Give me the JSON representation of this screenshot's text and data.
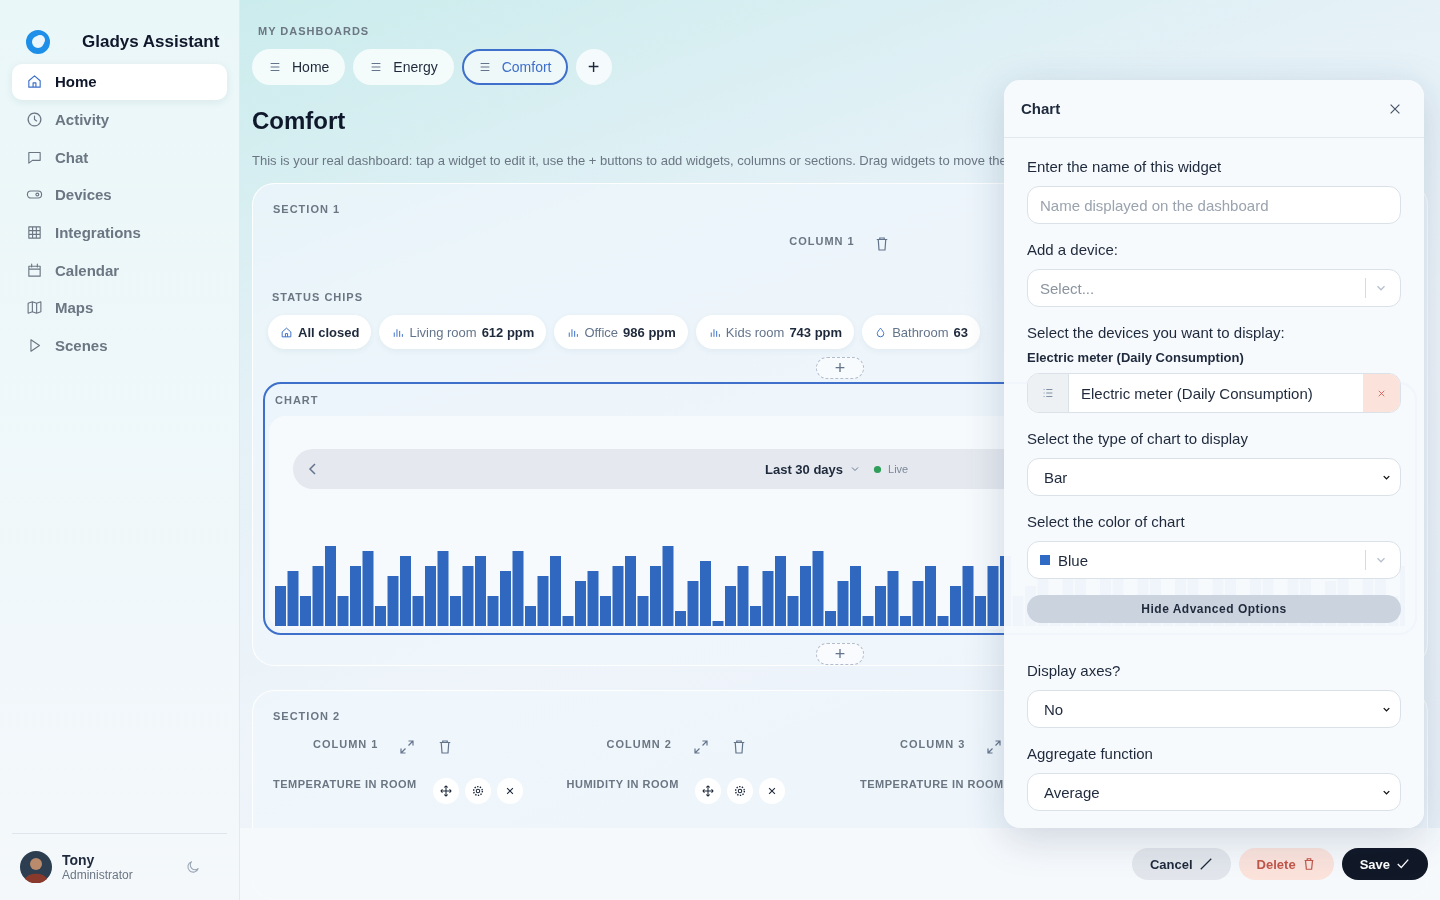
{
  "app": {
    "name": "Gladys Assistant"
  },
  "sidebar": {
    "items": [
      {
        "label": "Home",
        "selected": true
      },
      {
        "label": "Activity",
        "selected": false
      },
      {
        "label": "Chat",
        "selected": false
      },
      {
        "label": "Devices",
        "selected": false
      },
      {
        "label": "Integrations",
        "selected": false
      },
      {
        "label": "Calendar",
        "selected": false
      },
      {
        "label": "Maps",
        "selected": false
      },
      {
        "label": "Scenes",
        "selected": false
      }
    ]
  },
  "user": {
    "name": "Tony",
    "role": "Administrator"
  },
  "dashboards": {
    "heading": "MY DASHBOARDS",
    "tabs": [
      {
        "label": "Home",
        "selected": false
      },
      {
        "label": "Energy",
        "selected": false
      },
      {
        "label": "Comfort",
        "selected": true
      }
    ],
    "add": "+"
  },
  "page": {
    "title": "Comfort",
    "description": "This is your real dashboard: tap a widget to edit it, use the + buttons to add widgets, columns or sections. Drag widgets to move the"
  },
  "section_1": {
    "title": "SECTION 1",
    "column": "COLUMN 1",
    "status_chips": {
      "title": "STATUS CHIPS",
      "chips": [
        {
          "kind": "state",
          "label": "All closed"
        },
        {
          "kind": "co2",
          "label": "Living room",
          "value": "612 ppm"
        },
        {
          "kind": "co2",
          "label": "Office",
          "value": "986 ppm"
        },
        {
          "kind": "co2",
          "label": "Kids room",
          "value": "743 ppm"
        },
        {
          "kind": "humidity",
          "label": "Bathroom",
          "value": "63"
        }
      ]
    },
    "add_after_chips": "+",
    "chart_widget": {
      "title": "CHART",
      "selected": true,
      "period": "Last 30 days",
      "live": "Live"
    },
    "add_after_chart": "+"
  },
  "section_2": {
    "title": "SECTION 2",
    "columns": [
      {
        "title": "COLUMN 1",
        "widget": "TEMPERATURE IN ROOM",
        "tools": true
      },
      {
        "title": "COLUMN 2",
        "widget": "HUMIDITY IN ROOM",
        "tools": true
      },
      {
        "title": "COLUMN 3",
        "widget": "TEMPERATURE IN ROOM",
        "tools": false
      }
    ]
  },
  "modal": {
    "title": "Chart",
    "fields": [
      {
        "kind": "text",
        "label": "Enter the name of this widget",
        "placeholder": "Name displayed on the dashboard"
      },
      {
        "kind": "combo",
        "label": "Add a device:",
        "placeholder": "Select..."
      },
      {
        "kind": "devices",
        "label": "Select the devices you want to display:",
        "devices": [
          {
            "heading": "Electric meter (Daily Consumption)",
            "value": "Electric meter (Daily Consumption)"
          }
        ]
      },
      {
        "kind": "select",
        "label": "Select the type of chart to display",
        "value": "Bar"
      },
      {
        "kind": "color",
        "label": "Select the color of chart",
        "value": "Blue",
        "color": "#2f6bc4"
      },
      {
        "kind": "button",
        "label": "Hide Advanced Options"
      },
      {
        "kind": "select",
        "label": "Display axes?",
        "value": "No"
      },
      {
        "kind": "select",
        "label": "Aggregate function",
        "value": "Average"
      }
    ]
  },
  "footer": {
    "buttons": [
      {
        "kind": "cancel",
        "label": "Cancel"
      },
      {
        "kind": "delete",
        "label": "Delete"
      },
      {
        "kind": "save",
        "label": "Save"
      }
    ]
  }
}
